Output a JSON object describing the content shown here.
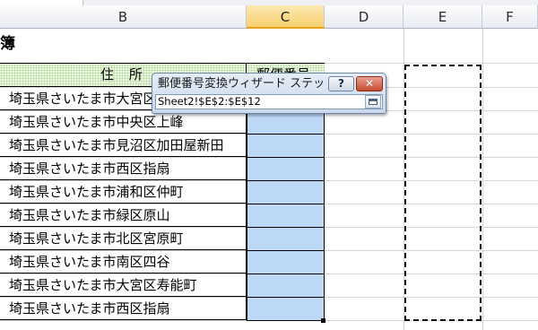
{
  "columns": {
    "b": "B",
    "c": "C",
    "d": "D",
    "e": "E",
    "f": "F"
  },
  "sheet_title_fragment": "簿",
  "table_header": {
    "address": "住 所",
    "postal": "郵便番号"
  },
  "addresses": [
    "埼玉県さいたま市大宮区",
    "埼玉県さいたま市中央区上峰",
    "埼玉県さいたま市見沼区加田屋新田",
    "埼玉県さいたま市西区指扇",
    "埼玉県さいたま市浦和区仲町",
    "埼玉県さいたま市緑区原山",
    "埼玉県さいたま市北区宮原町",
    "埼玉県さいたま市南区四谷",
    "埼玉県さいたま市大宮区寿能町",
    "埼玉県さいたま市西区指扇"
  ],
  "dialog": {
    "title": "郵便番号変換ウィザード ステッ...",
    "help_label": "?",
    "close_label": "✕",
    "range_value": "Sheet2!$E$2:$E$12",
    "help_icon": "question-icon",
    "close_icon": "close-icon",
    "collapse_icon": "collapse-dialog-icon"
  },
  "colors": {
    "selected_range": "#bcd8f5",
    "header_fill": "#e9f6df",
    "selected_column_header": "#f7cf6d",
    "close_button": "#c64b31"
  }
}
